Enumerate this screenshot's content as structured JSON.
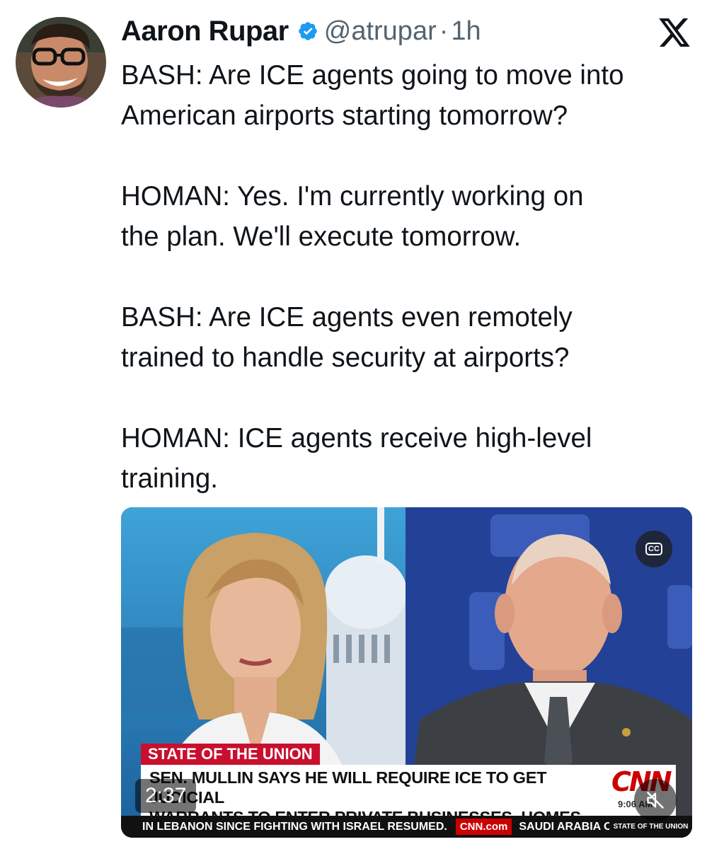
{
  "author": {
    "name": "Aaron Rupar",
    "handle": "@atrupar",
    "separator": "·",
    "time": "1h",
    "verified_color": "#1d9bf0"
  },
  "tweet": {
    "text": "BASH: Are ICE agents going to move into\nAmerican airports starting tomorrow?\n\nHOMAN: Yes. I'm currently working on\nthe plan. We'll execute tomorrow.\n\nBASH: Are ICE agents even remotely\ntrained to handle security at airports?\n\nHOMAN: ICE agents receive high-level\ntraining."
  },
  "video": {
    "duration": "2:37",
    "cc_label": "CC",
    "chyron": {
      "tag": "STATE OF THE UNION",
      "headline": "SEN. MULLIN SAYS HE WILL REQUIRE ICE TO GET JUDICIAL\nWARRANTS TO ENTER PRIVATE BUSINESSES, HOMES",
      "network": "CNN",
      "clock": "9:06 AM"
    },
    "ticker": {
      "text": "IN LEBANON SINCE FIGHTING WITH ISRAEL RESUMED.",
      "site": "CNN.com",
      "next": "SAUDI ARABIA OF",
      "show_logo": "STATE OF THE UNION"
    }
  },
  "icons": {
    "platform": "x-logo-icon",
    "verified": "verified-badge-icon",
    "captions": "closed-captions-icon",
    "mute": "muted-speaker-icon"
  },
  "colors": {
    "text": "#0f1419",
    "muted": "#536471",
    "cnn_red": "#cc0000",
    "chyron_red": "#c8102e"
  }
}
